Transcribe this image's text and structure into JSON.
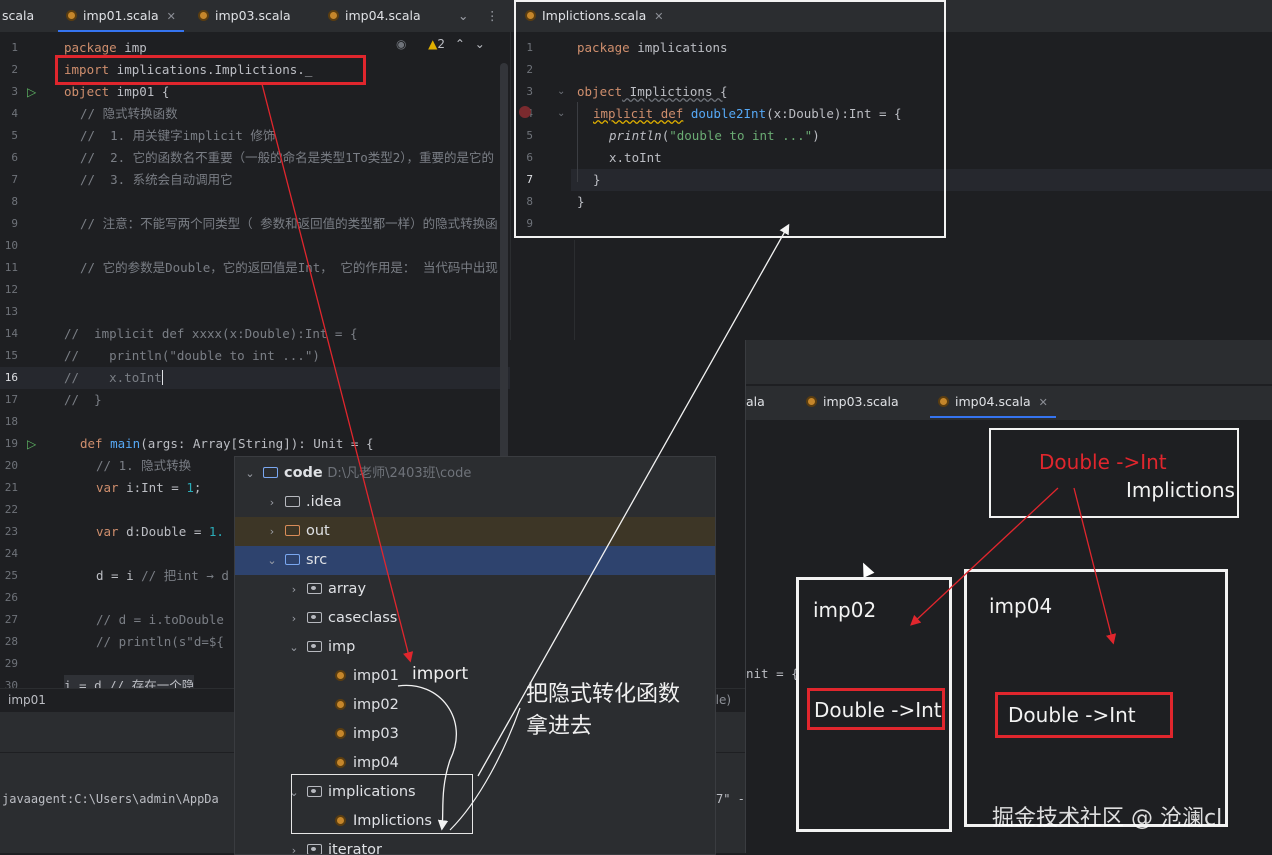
{
  "left_editor": {
    "tabs": [
      {
        "label": "scala",
        "active": false
      },
      {
        "label": "imp01.scala",
        "active": true
      },
      {
        "label": "imp03.scala",
        "active": false
      },
      {
        "label": "imp04.scala",
        "active": false
      }
    ],
    "warning_count": "2",
    "line_numbers": [
      "1",
      "2",
      "3",
      "4",
      "5",
      "6",
      "7",
      "8",
      "9",
      "10",
      "11",
      "12",
      "13",
      "14",
      "15",
      "16",
      "17",
      "18",
      "19",
      "20",
      "21",
      "22",
      "23",
      "24",
      "25",
      "26",
      "27",
      "28",
      "29",
      "30"
    ],
    "code": {
      "l1_kw": "package",
      "l1_rest": " imp",
      "l2_kw": "import",
      "l2_rest": " implications.Implictions._",
      "l3_kw": "object",
      "l3_rest": " imp01 {",
      "l4": "// 隐式转换函数",
      "l5": "//  1. 用关键字implicit 修饰",
      "l6": "//  2. 它的函数名不重要（一般的命名是类型1To类型2），重要的是它的",
      "l7": "//  3. 系统会自动调用它",
      "l9": "// 注意：不能写两个同类型（ 参数和返回值的类型都一样）的隐式转换函",
      "l11": "// 它的参数是Double，它的返回值是Int， 它的作用是： 当代码中出现",
      "l14": "//  implicit def xxxx(x:Double):Int = {",
      "l15": "//    println(\"double to int ...\")",
      "l16": "//    x.toInt",
      "l17": "//  }",
      "l19_kw": "def",
      "l19_fn": "main",
      "l19_rest": "(args: Array[String]): Unit = {",
      "l20": "// 1. 隐式转换",
      "l21_kw": "var",
      "l21_rest": " i:Int = ",
      "l21_num": "1",
      "l21_end": ";",
      "l23_kw": "var",
      "l23_rest": " d:Double = ",
      "l23_num": "1.",
      "l25_rest": "d = i ",
      "l25_cm": "// 把int → d",
      "l27": "// d = i.toDouble",
      "l28": "// println(s\"d=${",
      "l30": "i = d // 存在一个隐"
    },
    "breadcrumb": "imp01"
  },
  "right_editor": {
    "tab": "Implictions.scala",
    "line_numbers": [
      "1",
      "2",
      "3",
      "4",
      "5",
      "6",
      "7",
      "8",
      "9"
    ],
    "code": {
      "l1_kw": "package",
      "l1_rest": " implications",
      "l3_kw": "object",
      "l3_rest": " Implictions {",
      "l4_kw": "implicit def",
      "l4_fn": "double2Int",
      "l4_rest": "(x:Double):Int = {",
      "l5_fn": "println",
      "l5_str": "\"double to int ...\"",
      "l6": "x.toInt",
      "l7": "}",
      "l8": "}"
    }
  },
  "project_tree": {
    "root_label": "code",
    "root_path": "D:\\凡老师\\2403班\\code",
    "items": [
      {
        "label": ".idea",
        "kind": "folder"
      },
      {
        "label": "out",
        "kind": "folder"
      },
      {
        "label": "src",
        "kind": "folder"
      },
      {
        "label": "array",
        "kind": "package"
      },
      {
        "label": "caseclass",
        "kind": "package"
      },
      {
        "label": "imp",
        "kind": "package"
      },
      {
        "label": "imp01",
        "kind": "scala"
      },
      {
        "label": "imp02",
        "kind": "scala"
      },
      {
        "label": "imp03",
        "kind": "scala"
      },
      {
        "label": "imp04",
        "kind": "scala"
      },
      {
        "label": "implications",
        "kind": "package"
      },
      {
        "label": "Implictions",
        "kind": "scala"
      },
      {
        "label": "iterator",
        "kind": "package"
      }
    ]
  },
  "annotations": {
    "import_note": "import",
    "handwritten_line1": "把隐式转化函数",
    "handwritten_line2": "拿进去"
  },
  "bottom": {
    "run_line": "javaagent:C:\\Users\\admin\\AppDa",
    "run_tail": "7\" -"
  },
  "second_window": {
    "tabs": [
      {
        "label": "ala",
        "active": false
      },
      {
        "label": "imp03.scala",
        "active": false
      },
      {
        "label": "imp04.scala",
        "active": true
      }
    ],
    "peek_text1": "nit = {",
    "peek_text2": "ble)",
    "diagram": {
      "top_box_line1": "Double ->Int",
      "top_box_line2": "Implictions",
      "left_box_title": "imp02",
      "left_box_inner": "Double ->Int",
      "right_box_title": "imp04",
      "right_box_inner": "Double ->Int"
    }
  },
  "watermark": "掘金技术社区 @ 沧澜cl",
  "colors": {
    "editor_bg": "#1e1f22",
    "tab_bg": "#2b2d30",
    "accent": "#3574f0",
    "keyword": "#cf8e6d",
    "comment": "#7a7e85",
    "string": "#6aab73",
    "number": "#2aacb8",
    "function": "#56a8f5",
    "annotation_red": "#e0262d"
  }
}
